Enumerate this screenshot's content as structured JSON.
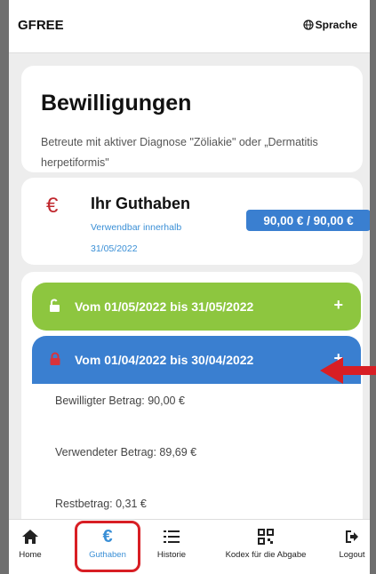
{
  "header": {
    "brand": "GFREE",
    "language_label": "Sprache"
  },
  "intro": {
    "title": "Bewilligungen",
    "description": "Betreute mit aktiver Diagnose \"Zöliakie\" oder „Dermatitis herpetiformis\""
  },
  "balance": {
    "currency_symbol": "€",
    "title": "Ihr Guthaben",
    "usable_until_label": "Verwendbar innerhalb",
    "usable_until_date": "31/05/2022",
    "amount": "90,00 € / 90,00 €"
  },
  "periods": [
    {
      "label": "Vom 01/05/2022 bis 31/05/2022",
      "status": "unlocked",
      "color": "#8dc63f",
      "toggle": "+"
    },
    {
      "label": "Vom 01/04/2022 bis 30/04/2022",
      "status": "locked",
      "color": "#3a7fd0",
      "toggle": "+",
      "details": {
        "approved": "Bewilligter Betrag: 90,00 €",
        "used": "Verwendeter Betrag: 89,69 €",
        "remaining": "Restbetrag: 0,31 €"
      }
    }
  ],
  "bottom_nav": [
    {
      "label": "Home",
      "icon": "home-icon"
    },
    {
      "label": "Guthaben",
      "icon": "euro-icon",
      "active": true
    },
    {
      "label": "Historie",
      "icon": "list-icon"
    },
    {
      "label": "Kodex für die Abgabe",
      "icon": "qr-code-icon"
    },
    {
      "label": "Logout",
      "icon": "logout-icon"
    }
  ],
  "annotation": {
    "arrow_color": "#d81e24",
    "highlight_color": "#d81e24"
  }
}
